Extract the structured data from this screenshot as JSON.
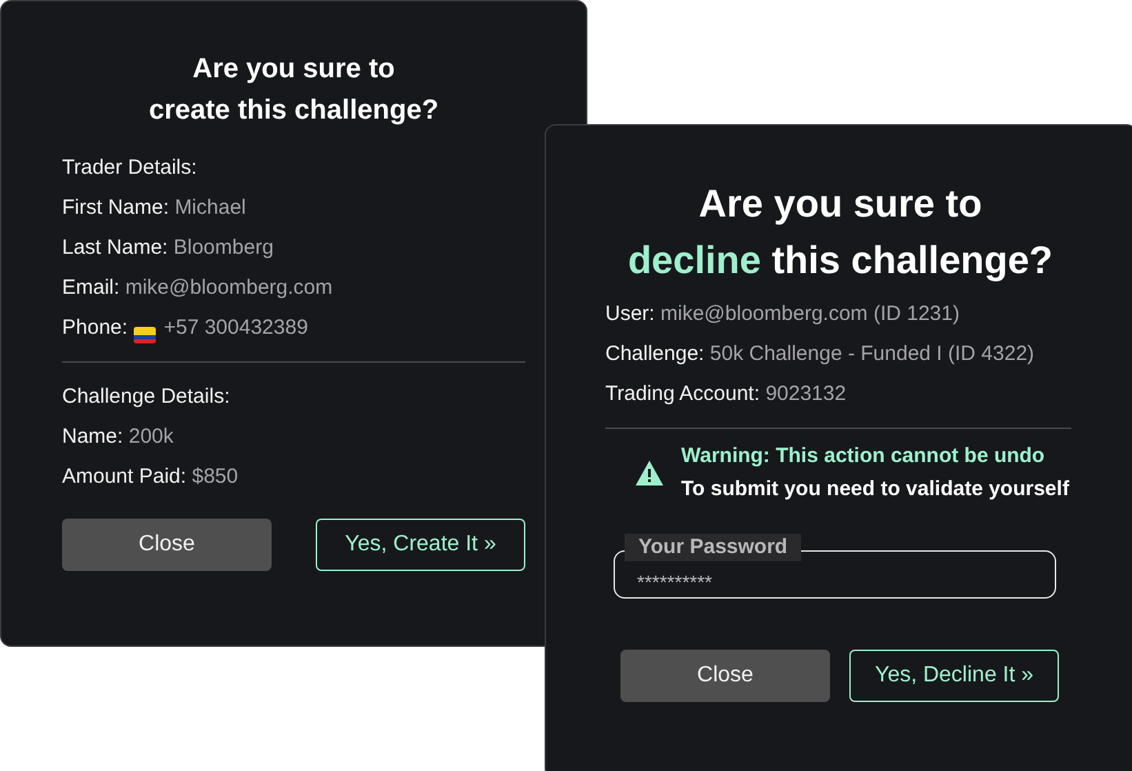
{
  "create_dialog": {
    "title_lines": [
      "Are you sure to",
      "create this challenge?"
    ],
    "trader_heading": "Trader Details:",
    "trader_fields": [
      {
        "label": "First Name:",
        "value": "Michael"
      },
      {
        "label": "Last Name:",
        "value": "Bloomberg"
      },
      {
        "label": "Email:",
        "value": "mike@bloomberg.com"
      },
      {
        "label": "Phone:",
        "value": "+57 300432389",
        "kind": "phone"
      }
    ],
    "challenge_heading": "Challenge Details:",
    "challenge_fields": [
      {
        "label": "Name:",
        "value": "200k"
      },
      {
        "label": "Amount Paid:",
        "value": "$850"
      }
    ],
    "buttons": [
      {
        "label": "Close",
        "kind": "secondary"
      },
      {
        "label": "Yes, Create It »",
        "kind": "primary"
      }
    ]
  },
  "decline_dialog": {
    "title_first": "Are you sure to",
    "title_highlight": "decline",
    "title_rest": "this challenge?",
    "fields": [
      {
        "label": "User:",
        "value": "mike@bloomberg.com (ID 1231)"
      },
      {
        "label": "Challenge:",
        "value": "50k Challenge - Funded I (ID 4322)"
      },
      {
        "label": "Trading Account:",
        "value": "9023132"
      }
    ],
    "warning": "Warning: This action cannot be undo",
    "instruction": "To submit you need to validate yourself",
    "password": {
      "label": "Your Password",
      "value": "**********"
    },
    "buttons": [
      {
        "label": "Close",
        "kind": "secondary"
      },
      {
        "label": "Yes, Decline It »",
        "kind": "primary"
      }
    ]
  }
}
